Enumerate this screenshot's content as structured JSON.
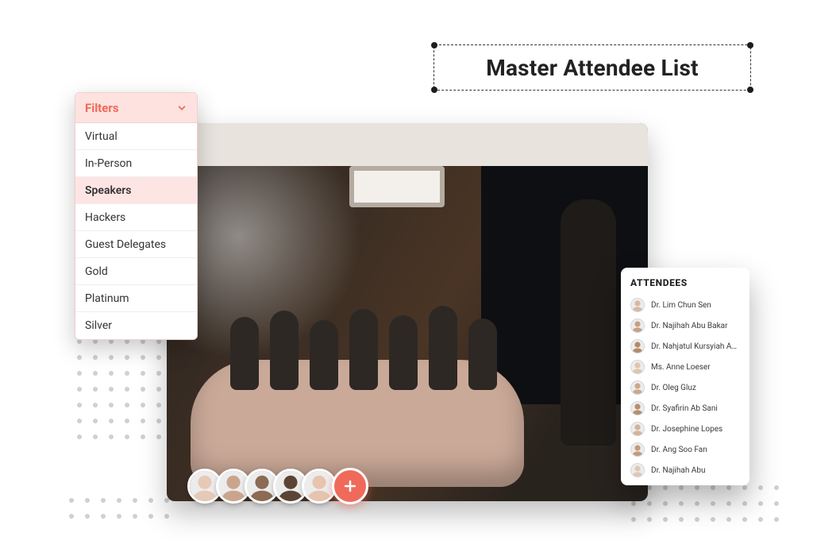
{
  "title": "Master Attendee List",
  "filters": {
    "heading": "Filters",
    "selected_index": 2,
    "options": [
      "Virtual",
      "In-Person",
      "Speakers",
      "Hackers",
      "Guest Delegates",
      "Gold",
      "Platinum",
      "Silver"
    ]
  },
  "avatar_strip": {
    "count": 5,
    "colors": [
      "#e6c9b6",
      "#caa58d",
      "#8b6b53",
      "#5b4433",
      "#e7c4ad"
    ]
  },
  "attendees": {
    "heading": "ATTENDEES",
    "items": [
      {
        "name": "Dr. Lim Chun Sen"
      },
      {
        "name": "Dr. Najihah Abu Bakar"
      },
      {
        "name": "Dr. Nahjatul Kursyiah Abd"
      },
      {
        "name": "Ms. Anne Loeser"
      },
      {
        "name": "Dr. Oleg Gluz"
      },
      {
        "name": "Dr. Syafirin Ab Sani"
      },
      {
        "name": "Dr. Josephine Lopes"
      },
      {
        "name": "Dr. Ang Soo Fan"
      },
      {
        "name": "Dr. Najihah Abu"
      }
    ]
  },
  "colors": {
    "accent": "#f06a5b",
    "accent_light": "#fde2df"
  }
}
